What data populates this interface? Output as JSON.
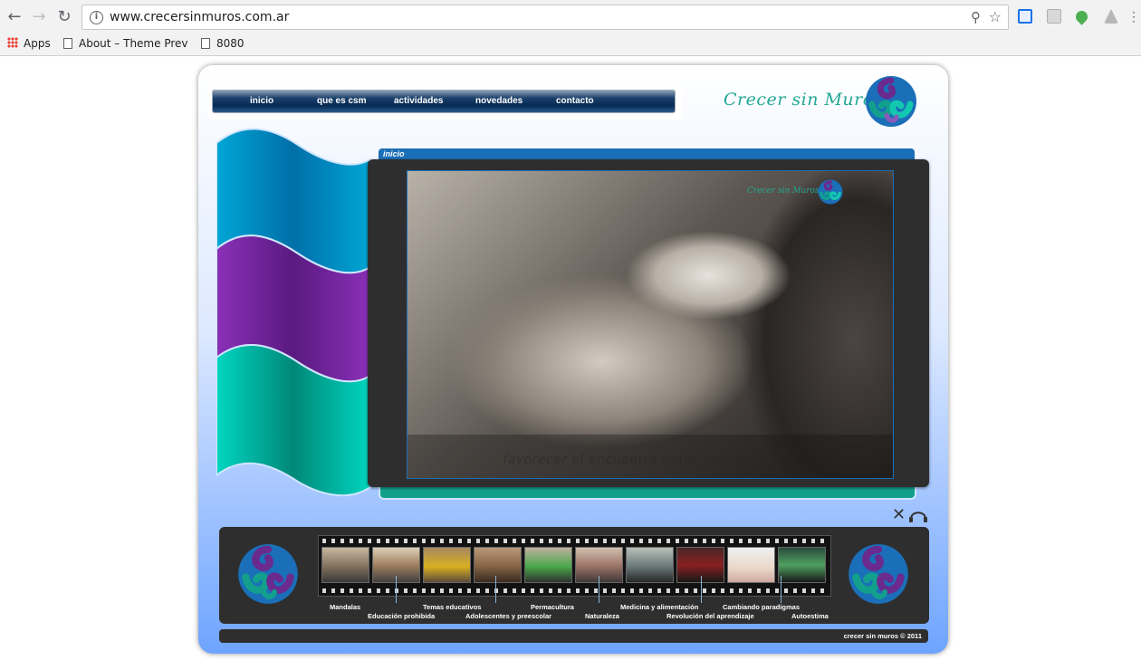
{
  "browser": {
    "url": "www.crecersinmuros.com.ar",
    "bookmarks": [
      {
        "label": "Apps"
      },
      {
        "label": "About – Theme Previe"
      },
      {
        "label": "8080"
      }
    ]
  },
  "site": {
    "nav": {
      "items": [
        {
          "label": "inicio"
        },
        {
          "label": "que es csm"
        },
        {
          "label": "actividades"
        },
        {
          "label": "novedades"
        },
        {
          "label": "contacto"
        }
      ]
    },
    "brand": {
      "name": "Crecer sin Muros"
    },
    "content": {
      "tab_label": "inicio",
      "caption": "favorecer el encuentro entre padres e hijos"
    },
    "categories": [
      {
        "label": "Mandalas"
      },
      {
        "label": "Educación prohibida"
      },
      {
        "label": "Temas educativos"
      },
      {
        "label": "Adolescentes y preescolar"
      },
      {
        "label": "Permacultura"
      },
      {
        "label": "Naturaleza"
      },
      {
        "label": "Medicina y alimentación"
      },
      {
        "label": "Revolución del aprendizaje"
      },
      {
        "label": "Cambiando paradigmas"
      },
      {
        "label": "Autoestima"
      }
    ],
    "footer": "crecer sin muros © 2011"
  },
  "colors": {
    "teal": "#12a08c",
    "purple": "#6a2a8e",
    "blue": "#1a6fb8",
    "panel": "#2e2e2e"
  }
}
